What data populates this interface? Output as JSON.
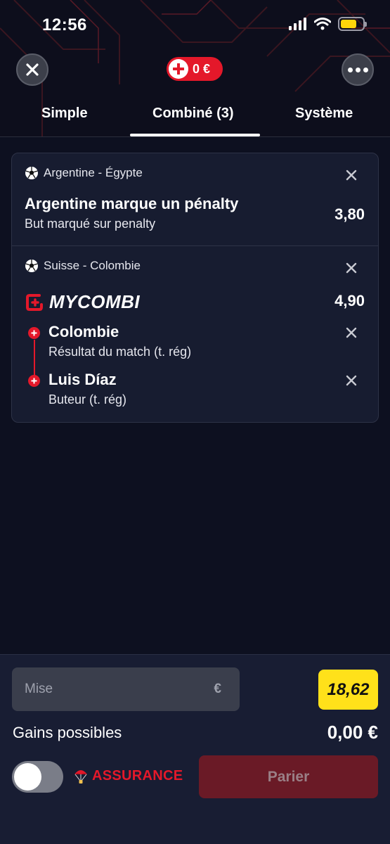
{
  "status_bar": {
    "time": "12:56",
    "icons": [
      "signal-icon",
      "wifi-icon",
      "battery-icon"
    ]
  },
  "header": {
    "close_icon": "close-icon",
    "balance": "0 €",
    "more_icon": "more-icon"
  },
  "tabs": [
    {
      "label": "Simple",
      "active": false
    },
    {
      "label": "Combiné (3)",
      "active": true
    },
    {
      "label": "Système",
      "active": false
    }
  ],
  "bets": [
    {
      "event": "Argentine - Égypte",
      "selection": "Argentine marque un pénalty",
      "market": "But marqué sur penalty",
      "odds": "3,80"
    },
    {
      "event": "Suisse - Colombie",
      "brand": "MYCOMBI",
      "odds": "4,90",
      "legs": [
        {
          "selection": "Colombie",
          "market": "Résultat du match (t. rég)"
        },
        {
          "selection": "Luis Díaz",
          "market": "Buteur (t. rég)"
        }
      ]
    }
  ],
  "footer": {
    "stake_placeholder": "Mise",
    "currency": "€",
    "total_odds": "18,62",
    "gains_label": "Gains possibles",
    "gains_value": "0,00 €",
    "insurance_toggle_on": false,
    "insurance_label": "ASSURANCE",
    "submit_label": "Parier"
  },
  "colors": {
    "accent": "#e4182a",
    "odds_badge": "#ffe11a",
    "background": "#0d1020",
    "card": "#171c30"
  }
}
